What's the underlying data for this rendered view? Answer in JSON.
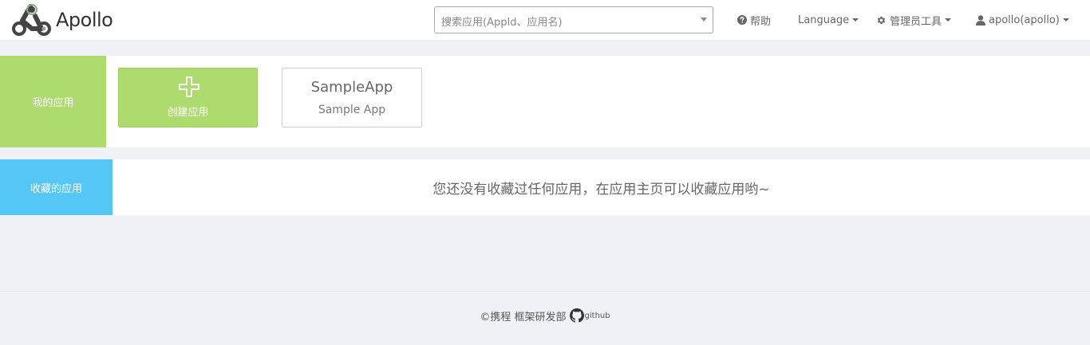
{
  "brand": {
    "name": "Apollo"
  },
  "search": {
    "placeholder": "搜索应用(AppId、应用名)"
  },
  "nav": {
    "help": "帮助",
    "language": "Language",
    "admin_tools": "管理员工具",
    "user": "apollo(apollo)"
  },
  "my_apps": {
    "label": "我的应用",
    "create_label": "创建应用",
    "apps": [
      {
        "app_id": "SampleApp",
        "name": "Sample App"
      }
    ]
  },
  "favorites": {
    "label": "收藏的应用",
    "empty_message": "您还没有收藏过任何应用，在应用主页可以收藏应用哟~"
  },
  "footer": {
    "copyright": "©携程 框架研发部",
    "github": "github"
  },
  "colors": {
    "my_apps_green": "#addb6d",
    "favorites_blue": "#55c7f5",
    "page_bg": "#f0f1f6"
  },
  "icons": {
    "help": "question-circle-icon",
    "admin": "gear-icon",
    "user": "user-icon",
    "create": "plus-icon",
    "github": "github-icon"
  }
}
